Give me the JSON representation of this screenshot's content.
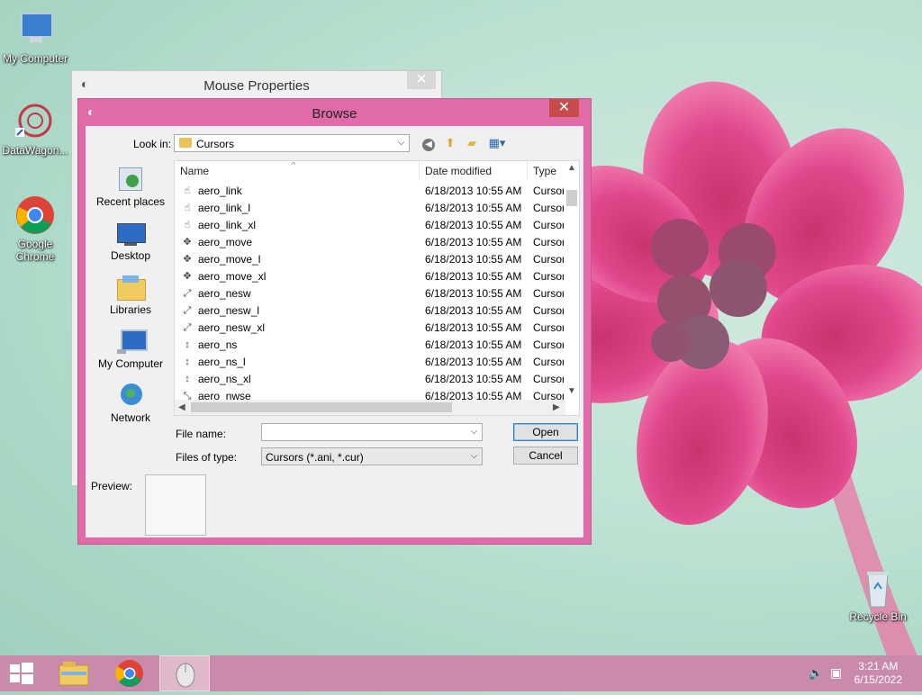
{
  "desktop": {
    "icons": [
      {
        "label": "My Computer"
      },
      {
        "label": "DataWagon..."
      },
      {
        "label": "Google Chrome"
      },
      {
        "label": "Recycle Bin"
      }
    ]
  },
  "mouse_properties": {
    "title": "Mouse Properties",
    "close": "✕"
  },
  "browse": {
    "title": "Browse",
    "close": "✕",
    "look_in_label": "Look in:",
    "look_in_value": "Cursors",
    "places": [
      {
        "label": "Recent places"
      },
      {
        "label": "Desktop"
      },
      {
        "label": "Libraries"
      },
      {
        "label": "My Computer"
      },
      {
        "label": "Network"
      }
    ],
    "columns": {
      "name": "Name",
      "date": "Date modified",
      "type": "Type"
    },
    "files": [
      {
        "name": "aero_link",
        "date": "6/18/2013 10:55 AM",
        "type": "Cursor",
        "icon": "☝"
      },
      {
        "name": "aero_link_l",
        "date": "6/18/2013 10:55 AM",
        "type": "Cursor",
        "icon": "☝"
      },
      {
        "name": "aero_link_xl",
        "date": "6/18/2013 10:55 AM",
        "type": "Cursor",
        "icon": "☝"
      },
      {
        "name": "aero_move",
        "date": "6/18/2013 10:55 AM",
        "type": "Cursor",
        "icon": "✥"
      },
      {
        "name": "aero_move_l",
        "date": "6/18/2013 10:55 AM",
        "type": "Cursor",
        "icon": "✥"
      },
      {
        "name": "aero_move_xl",
        "date": "6/18/2013 10:55 AM",
        "type": "Cursor",
        "icon": "✥"
      },
      {
        "name": "aero_nesw",
        "date": "6/18/2013 10:55 AM",
        "type": "Cursor",
        "icon": "⤢"
      },
      {
        "name": "aero_nesw_l",
        "date": "6/18/2013 10:55 AM",
        "type": "Cursor",
        "icon": "⤢"
      },
      {
        "name": "aero_nesw_xl",
        "date": "6/18/2013 10:55 AM",
        "type": "Cursor",
        "icon": "⤢"
      },
      {
        "name": "aero_ns",
        "date": "6/18/2013 10:55 AM",
        "type": "Cursor",
        "icon": "↕"
      },
      {
        "name": "aero_ns_l",
        "date": "6/18/2013 10:55 AM",
        "type": "Cursor",
        "icon": "↕"
      },
      {
        "name": "aero_ns_xl",
        "date": "6/18/2013 10:55 AM",
        "type": "Cursor",
        "icon": "↕"
      },
      {
        "name": "aero_nwse",
        "date": "6/18/2013 10:55 AM",
        "type": "Cursor",
        "icon": "⤡"
      }
    ],
    "file_name_label": "File name:",
    "file_name_value": "",
    "files_of_type_label": "Files of type:",
    "files_of_type_value": "Cursors (*.ani, *.cur)",
    "open_label": "Open",
    "cancel_label": "Cancel",
    "preview_label": "Preview:"
  },
  "taskbar": {
    "time": "3:21 AM",
    "date": "6/15/2022"
  },
  "colors": {
    "accent": "#e06ba8",
    "taskbar": "#c98aab",
    "close": "#c74b4b"
  }
}
